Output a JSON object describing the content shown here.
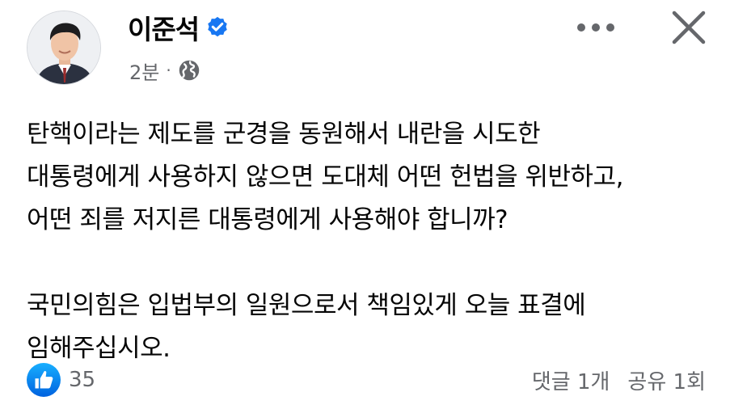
{
  "post": {
    "author": "이준석",
    "timestamp": "2분",
    "separator": "·",
    "paragraphs": [
      [
        "탄핵이라는 제도를 군경을 동원해서 내란을 시도한",
        "대통령에게 사용하지 않으면 도대체 어떤 헌법을 위반하고,",
        "어떤 죄를 저지른 대통령에게 사용해야 합니까?"
      ],
      [
        "국민의힘은 입법부의 일원으로서 책임있게 오늘 표결에",
        "임해주십시오."
      ]
    ],
    "reactions": {
      "icon": "like-icon",
      "count": "35",
      "color": "#1877f2"
    },
    "comments_label": "댓글 1개",
    "shares_label": "공유 1회"
  },
  "icons": {
    "verified": "verified-badge-icon",
    "privacy": "globe-icon",
    "more": "more-dots-icon",
    "close": "close-icon"
  },
  "colors": {
    "accent": "#1877f2",
    "secondary_text": "#65676b",
    "primary_text": "#050505"
  }
}
